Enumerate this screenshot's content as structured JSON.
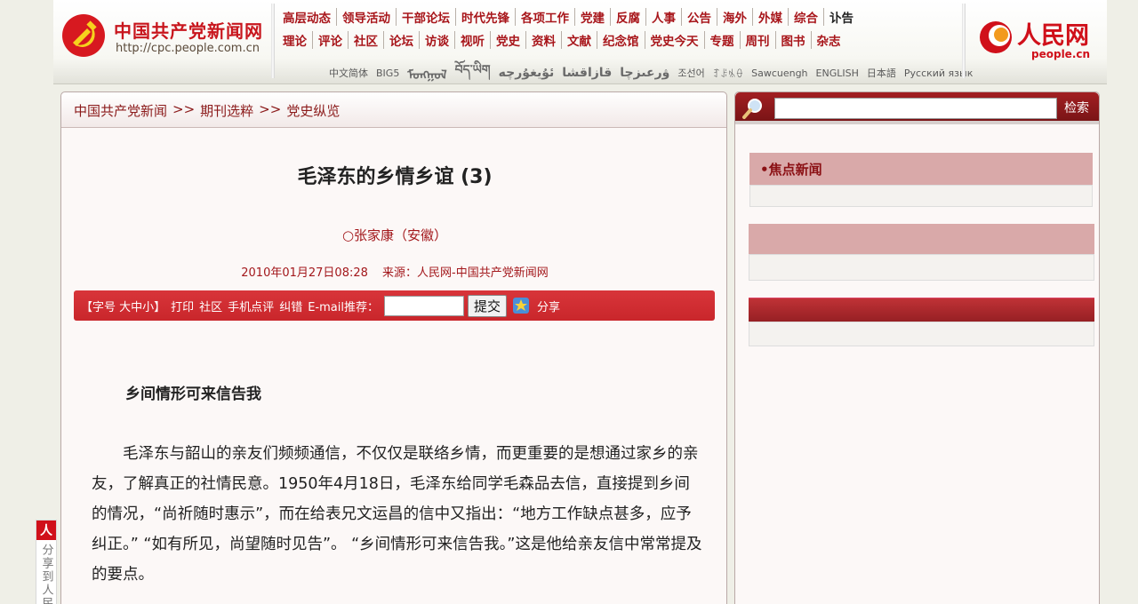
{
  "header": {
    "cpc_title": "中国共产党新闻网",
    "cpc_url": "http://cpc.people.com.cn",
    "nav_row1": [
      "高层动态",
      "领导活动",
      "干部论坛",
      "时代先锋",
      "各项工作",
      "党建",
      "反腐",
      "人事",
      "公告",
      "海外",
      "外媒",
      "综合",
      "讣告"
    ],
    "nav_row2": [
      "理论",
      "评论",
      "社区",
      "论坛",
      "访谈",
      "视听",
      "党史",
      "资料",
      "文献",
      "纪念馆",
      "党史今天",
      "专题",
      "周刊",
      "图书",
      "杂志"
    ],
    "languages": [
      "中文简体",
      "BIG5",
      "ᠮᠣᠩᠭᠣᠯ",
      "བོད་ཡིག",
      "ئۇيغۇرچە",
      "قازاقشا",
      "ۋرعىزچا",
      "조선어",
      "ꆈꌠꁱꂷ",
      "Sawcuengh",
      "ENGLISH",
      "日本語",
      "Русский язык"
    ],
    "people_cn": "人民网",
    "people_url": "people.cn"
  },
  "breadcrumb": [
    "中国共产党新闻",
    ">>",
    "期刊选粹",
    ">>",
    "党史纵览"
  ],
  "article": {
    "title": "毛泽东的乡情乡谊 (3)",
    "author": "○张家康（安徽）",
    "date": "2010年01月27日08:28",
    "source": "来源：人民网-中国共产党新闻网",
    "section_heading": "乡间情形可来信告我",
    "body": "毛泽东与韶山的亲友们频频通信，不仅仅是联络乡情，而更重要的是想通过家乡的亲友，了解真正的社情民意。1950年4月18日，毛泽东给同学毛森品去信，直接提到乡间的情况，“尚祈随时惠示”，而在给表兄文运昌的信中又指出：“地方工作缺点甚多，应予纠正。” “如有所见，尚望随时见告”。 “乡间情形可来信告我。”这是他给亲友信中常常提及的要点。"
  },
  "toolbar": {
    "font_size": "【字号 大中小】",
    "print": "打印",
    "community": "社区",
    "mobile": "手机点评",
    "correct": "纠错",
    "email_label": "E-mail推荐：",
    "submit": "提交",
    "share": "分享"
  },
  "sidebar": {
    "search_button": "检索",
    "box1_title": "•焦点新闻"
  },
  "float_share": {
    "logo": "人",
    "text": "分享到人民"
  },
  "colors": {
    "brand_red": "#c8161d",
    "toolbar_red": "#cf2c31",
    "sidebar_head": "#d9a9a9"
  }
}
